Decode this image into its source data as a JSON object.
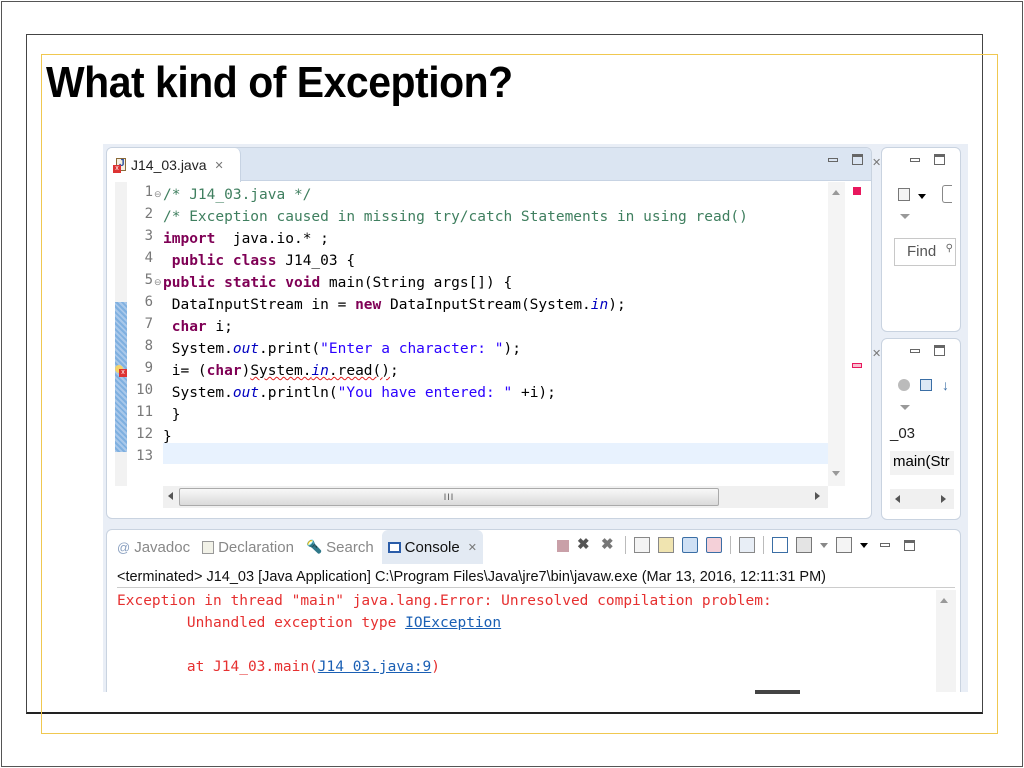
{
  "slide": {
    "title": "What kind of Exception?"
  },
  "editor": {
    "tab_label": "J14_03.java",
    "tab_close": "✕",
    "lines": [
      {
        "no": "1",
        "fold": true
      },
      {
        "no": "2"
      },
      {
        "no": "3"
      },
      {
        "no": "4"
      },
      {
        "no": "5",
        "fold": true
      },
      {
        "no": "6"
      },
      {
        "no": "7"
      },
      {
        "no": "8"
      },
      {
        "no": "9",
        "error": true
      },
      {
        "no": "10"
      },
      {
        "no": "11"
      },
      {
        "no": "12"
      },
      {
        "no": "13"
      }
    ],
    "code": {
      "l1": "/* J14_03.java */",
      "l2": "/* Exception caused in missing try/catch Statements in using read()",
      "l3_kw": "import",
      "l3_rest": "  java.io.* ;",
      "l4_kw1": "public",
      "l4_kw2": "class",
      "l4_rest": " J14_03 {",
      "l5_kw1": "public",
      "l5_kw2": "static",
      "l5_kw3": "void",
      "l5_rest": " main(String args[]) {",
      "l6_a": " DataInputStream in = ",
      "l6_kw": "new",
      "l6_b": " DataInputStream(System.",
      "l6_it": "in",
      "l6_c": ");",
      "l7_kw": "char",
      "l7_rest": " i;",
      "l8_a": " System.",
      "l8_it": "out",
      "l8_b": ".print(",
      "l8_st": "\"Enter a character: \"",
      "l8_c": ");",
      "l9_a": " i= (",
      "l9_kw": "char",
      "l9_b": ")",
      "l9_sq1": "System.",
      "l9_it": "in",
      "l9_sq2": ".read()",
      "l9_c": ";",
      "l10_a": " System.",
      "l10_it": "out",
      "l10_b": ".println(",
      "l10_st": "\"You have entered: \"",
      "l10_c": " +i);",
      "l11": " }",
      "l12": "}",
      "l13": ""
    },
    "hscroll_grip": "III"
  },
  "side_top": {
    "find_placeholder": "Find",
    "tab_close": "✕"
  },
  "side_bottom": {
    "tab_close": "✕",
    "item1": "_03",
    "item2": "main(Str"
  },
  "console": {
    "tabs": [
      {
        "label": "Javadoc",
        "icon": "@"
      },
      {
        "label": "Declaration",
        "icon": "declaration-icon"
      },
      {
        "label": "Search",
        "icon": "search-icon"
      },
      {
        "label": "Console",
        "icon": "console-icon",
        "active": true
      }
    ],
    "tab_close": "✕",
    "header": "<terminated> J14_03 [Java Application] C:\\Program Files\\Java\\jre7\\bin\\javaw.exe (Mar 13, 2016, 12:11:31 PM)",
    "output": {
      "line1": "Exception in thread \"main\" java.lang.Error: Unresolved compilation problem: ",
      "line2_prefix": "        Unhandled exception type ",
      "line2_link": "IOException",
      "line3": "",
      "line4_prefix": "        at J14_03.main(",
      "line4_link": "J14 03.java:9",
      "line4_suffix": ")"
    }
  },
  "colors": {
    "keyword": "#7f0055",
    "comment": "#3f7f5f",
    "string": "#2a00ff",
    "error_text": "#e63030",
    "link": "#1a5fb4",
    "slide_gold_border": "#f0c850"
  }
}
